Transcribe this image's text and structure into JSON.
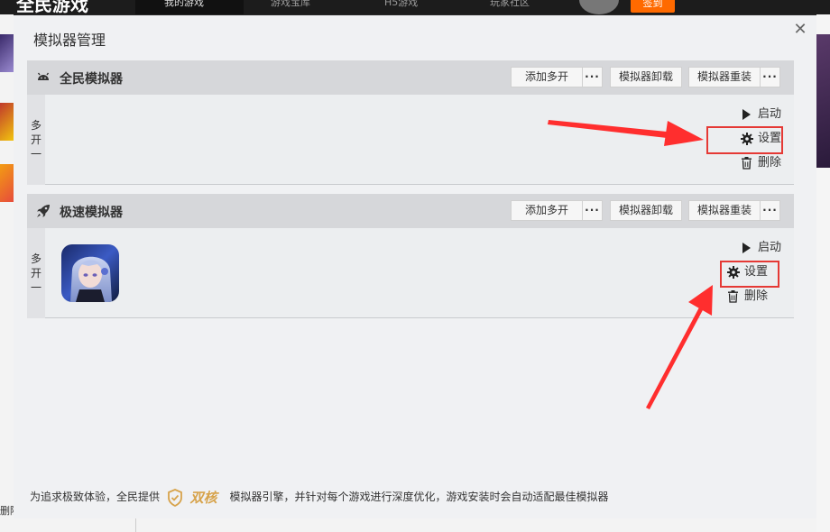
{
  "background": {
    "logo": "全民游戏",
    "tabs": [
      "我的游戏",
      "游戏宝库",
      "H5游戏",
      "玩家社区"
    ],
    "signin_label": "签到",
    "left_side_text": "删除"
  },
  "dialog": {
    "title": "模拟器管理",
    "close_glyph": "✕",
    "sections": [
      {
        "name": "全民模拟器",
        "icon": "android-icon",
        "buttons": {
          "add_multi": "添加多开",
          "uninstall": "模拟器卸载",
          "reinstall": "模拟器重装",
          "more": "···"
        },
        "multi_label": "多开一",
        "actions": {
          "start": "启动",
          "settings": "设置",
          "delete": "删除"
        },
        "has_game": false
      },
      {
        "name": "极速模拟器",
        "icon": "rocket-icon",
        "buttons": {
          "add_multi": "添加多开",
          "uninstall": "模拟器卸载",
          "reinstall": "模拟器重装",
          "more": "···"
        },
        "multi_label": "多开一",
        "actions": {
          "start": "启动",
          "settings": "设置",
          "delete": "删除"
        },
        "has_game": true
      }
    ],
    "footer": {
      "prefix": "为追求极致体验，全民提供",
      "brand": "双核",
      "suffix": "模拟器引擎，并针对每个游戏进行深度优化，游戏安装时会自动适配最佳模拟器"
    }
  },
  "colors": {
    "highlight": "#e53935",
    "accent": "#ff6a00",
    "brand_gold": "#d7a34b"
  }
}
